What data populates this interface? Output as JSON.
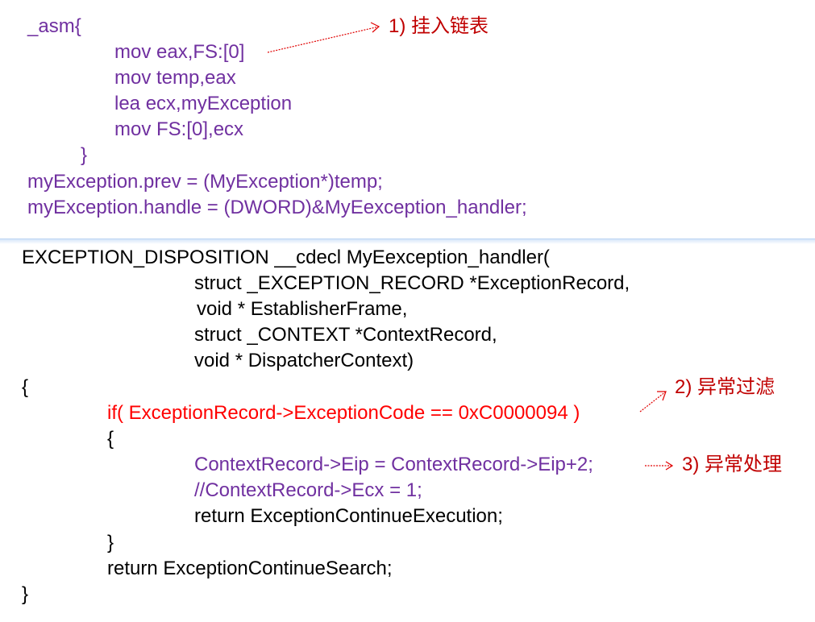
{
  "top_block": {
    "lines": [
      "_asm{",
      "mov eax,FS:[0]",
      "mov temp,eax",
      "lea ecx,myException",
      "mov FS:[0],ecx",
      "}",
      "myException.prev = (MyException*)temp;",
      "myException.handle = (DWORD)&MyEexception_handler;"
    ]
  },
  "bottom_block": {
    "lines": [
      "EXCEPTION_DISPOSITION __cdecl MyEexception_handler(",
      "struct _EXCEPTION_RECORD *ExceptionRecord,",
      "void * EstablisherFrame,",
      "struct _CONTEXT *ContextRecord,",
      "void * DispatcherContext)",
      "{",
      "if( ExceptionRecord->ExceptionCode == 0xC0000094 )",
      "{",
      "ContextRecord->Eip = ContextRecord->Eip+2;",
      "//ContextRecord->Ecx = 1;",
      "return ExceptionContinueExecution;",
      "}",
      "return ExceptionContinueSearch;",
      "}"
    ]
  },
  "annotations": [
    "1) 挂入链表",
    "2) 异常过滤",
    "3) 异常处理"
  ],
  "colors": {
    "code_purple": "#7030a0",
    "filter_red": "#ff0000",
    "annotation_red": "#c00000"
  }
}
